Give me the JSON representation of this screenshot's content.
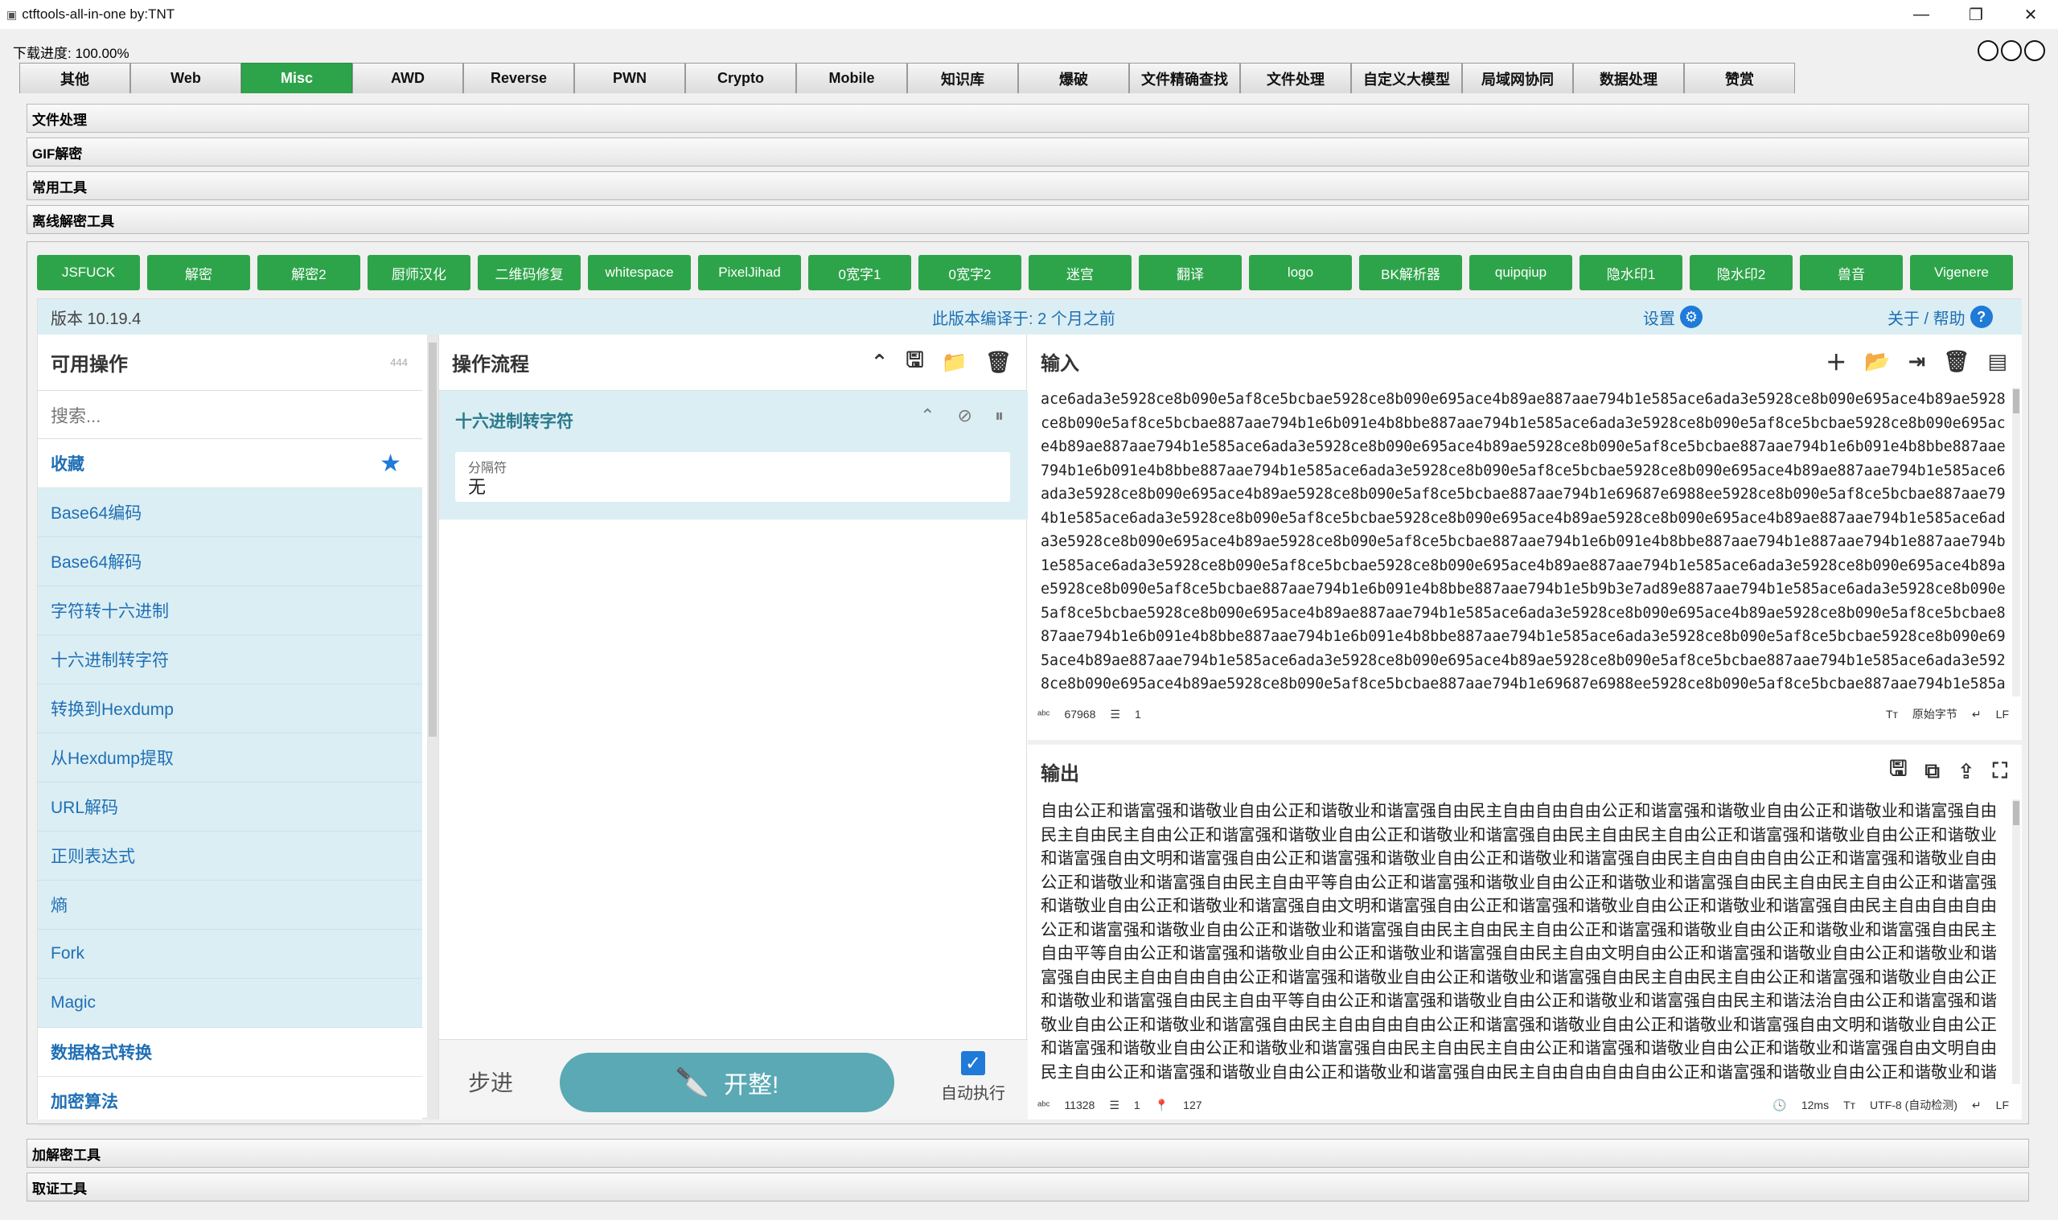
{
  "window": {
    "title": "ctftools-all-in-one   by:TNT",
    "minimize": "—",
    "maximize": "❐",
    "close": "✕"
  },
  "download_progress": "下载进度: 100.00%",
  "main_tabs": [
    "其他",
    "Web",
    "Misc",
    "AWD",
    "Reverse",
    "PWN",
    "Crypto",
    "Mobile",
    "知识库",
    "爆破",
    "文件精确查找",
    "文件处理",
    "自定义大模型",
    "局域网协同",
    "数据处理",
    "赞赏"
  ],
  "active_tab": "Misc",
  "top_sections": [
    "文件处理",
    "GIF解密",
    "常用工具",
    "离线解密工具"
  ],
  "bottom_sections": [
    "加解密工具",
    "取证工具"
  ],
  "tool_buttons": [
    "JSFUCK",
    "解密",
    "解密2",
    "厨师汉化",
    "二维码修复",
    "whitespace",
    "PixelJihad",
    "0宽字1",
    "0宽字2",
    "迷宫",
    "翻译",
    "logo",
    "BK解析器",
    "quipqiup",
    "隐水印1",
    "隐水印2",
    "兽音",
    "Vigenere"
  ],
  "cyberchef": {
    "version": "版本 10.19.4",
    "built": "此版本编译于: 2 个月之前",
    "settings": "设置",
    "about": "关于 / 帮助",
    "ops": {
      "title": "可用操作",
      "count": "444",
      "search_placeholder": "搜索...",
      "favorites": "收藏",
      "items": [
        "Base64编码",
        "Base64解码",
        "字符转十六进制",
        "十六进制转字符",
        "转换到Hexdump",
        "从Hexdump提取",
        "URL解码",
        "正则表达式",
        "熵",
        "Fork",
        "Magic"
      ],
      "categories": [
        "数据格式转换",
        "加密算法"
      ]
    },
    "recipe": {
      "title": "操作流程",
      "operation": "十六进制转字符",
      "arg_label": "分隔符",
      "arg_value": "无",
      "step": "步进",
      "bake": "开整!",
      "auto_bake": "自动执行"
    },
    "input": {
      "title": "输入",
      "text": "ace6ada3e5928ce8b090e5af8ce5bcbae5928ce8b090e695ace4b89ae887aae794b1e585ace6ada3e5928ce8b090e695ace4b89ae5928ce8b090e5af8ce5bcbae887aae794b1e6b091e4b8bbe887aae794b1e585ace6ada3e5928ce8b090e5af8ce5bcbae5928ce8b090e695ace4b89ae887aae794b1e585ace6ada3e5928ce8b090e695ace4b89ae5928ce8b090e5af8ce5bcbae887aae794b1e6b091e4b8bbe887aae794b1e6b091e4b8bbe887aae794b1e585ace6ada3e5928ce8b090e5af8ce5bcbae5928ce8b090e695ace4b89ae887aae794b1e585ace6ada3e5928ce8b090e695ace4b89ae5928ce8b090e5af8ce5bcbae887aae794b1e69687e6988ee5928ce8b090e5af8ce5bcbae887aae794b1e585ace6ada3e5928ce8b090e5af8ce5bcbae5928ce8b090e695ace4b89ae5928ce8b090e695ace4b89ae887aae794b1e585ace6ada3e5928ce8b090e695ace4b89ae5928ce8b090e5af8ce5bcbae887aae794b1e6b091e4b8bbe887aae794b1e887aae794b1e887aae794b1e585ace6ada3e5928ce8b090e5af8ce5bcbae5928ce8b090e695ace4b89ae887aae794b1e585ace6ada3e5928ce8b090e695ace4b89ae5928ce8b090e5af8ce5bcbae887aae794b1e6b091e4b8bbe887aae794b1e5b9b3e7ad89e887aae794b1e585ace6ada3e5928ce8b090e5af8ce5bcbae5928ce8b090e695ace4b89ae887aae794b1e585ace6ada3e5928ce8b090e695ace4b89ae5928ce8b090e5af8ce5bcbae887aae794b1e6b091e4b8bbe887aae794b1e6b091e4b8bbe887aae794b1e585ace6ada3e5928ce8b090e5af8ce5bcbae5928ce8b090e695ace4b89ae887aae794b1e585ace6ada3e5928ce8b090e695ace4b89ae5928ce8b090e5af8ce5bcbae887aae794b1e585ace6ada3e5928ce8b090e695ace4b89ae5928ce8b090e5af8ce5bcbae887aae794b1e69687e6988ee5928ce8b090e5af8ce5bcbae887aae794b1e585ace6ada3",
      "length": "67968",
      "lines": "1",
      "charset": "原始字节",
      "eol": "LF"
    },
    "output": {
      "title": "输出",
      "text": "自由公正和谐富强和谐敬业自由公正和谐敬业和谐富强自由民主自由自由自由公正和谐富强和谐敬业自由公正和谐敬业和谐富强自由民主自由民主自由公正和谐富强和谐敬业自由公正和谐敬业和谐富强自由民主自由民主自由公正和谐富强和谐敬业自由公正和谐敬业和谐富强自由文明和谐富强自由公正和谐富强和谐敬业自由公正和谐敬业和谐富强自由民主自由自由自由公正和谐富强和谐敬业自由公正和谐敬业和谐富强自由民主自由平等自由公正和谐富强和谐敬业自由公正和谐敬业和谐富强自由民主自由民主自由公正和谐富强和谐敬业自由公正和谐敬业和谐富强自由文明和谐富强自由公正和谐富强和谐敬业自由公正和谐敬业和谐富强自由民主自由自由自由公正和谐富强和谐敬业自由公正和谐敬业和谐富强自由民主自由民主自由公正和谐富强和谐敬业自由公正和谐敬业和谐富强自由民主自由平等自由公正和谐富强和谐敬业自由公正和谐敬业和谐富强自由民主自由文明自由公正和谐富强和谐敬业自由公正和谐敬业和谐富强自由民主自由自由自由公正和谐富强和谐敬业自由公正和谐敬业和谐富强自由民主自由民主自由公正和谐富强和谐敬业自由公正和谐敬业和谐富强自由民主自由平等自由公正和谐富强和谐敬业自由公正和谐敬业和谐富强自由民主和谐法治自由公正和谐富强和谐敬业自由公正和谐敬业和谐富强自由民主自由自由自由公正和谐富强和谐敬业自由公正和谐敬业和谐富强自由文明和谐敬业自由公正和谐富强和谐敬业自由公正和谐敬业和谐富强自由民主自由民主自由公正和谐富强和谐敬业自由公正和谐敬业和谐富强自由文明自由民主自由公正和谐富强和谐敬业自由公正和谐敬业和谐富强自由民主自由自由自由自由公正和谐富强和谐敬业自由公正和谐敬业和谐富强自由民主自由平等自由公正和谐富强和谐敬业自由公正和谐敬业和谐富强自由民主自由自由公正和",
      "length": "11328",
      "lines": "1",
      "position": "127",
      "time": "12ms",
      "charset": "UTF-8 (自动检测)",
      "eol": "LF"
    }
  },
  "colors": {
    "accent_green": "#2ea44a",
    "cyberchef_blue": "#1f6fb5",
    "banner_bg": "#dbeef3",
    "bake_btn": "#5aa9b5"
  }
}
